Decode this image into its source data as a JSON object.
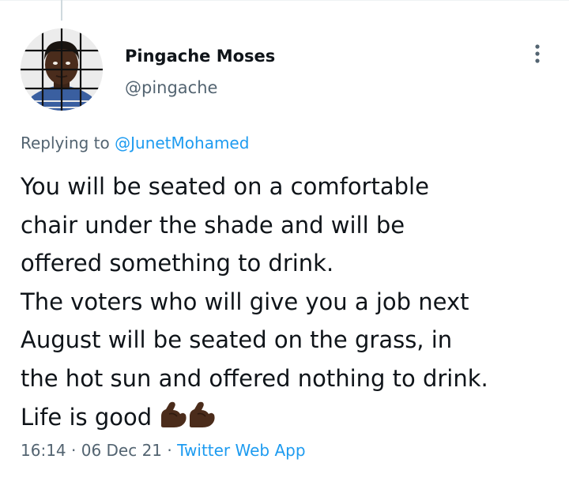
{
  "author": {
    "display_name": "Pingache Moses",
    "handle": "@pingache"
  },
  "reply": {
    "prefix": "Replying to",
    "mention": "@JunetMohamed"
  },
  "tweet": {
    "lines": [
      "You will be seated on a comfortable",
      "chair under the shade and will be",
      "offered something to drink.",
      "The voters who will give you a job next",
      "August will be seated on the grass, in",
      "the hot sun and offered nothing to drink.",
      "Life is good"
    ],
    "emoji": [
      "flexed-biceps-dark-skin",
      "flexed-biceps-dark-skin"
    ]
  },
  "meta": {
    "time": "16:14",
    "separator": "·",
    "date": "06 Dec 21",
    "source": "Twitter Web App"
  },
  "icons": {
    "more": "more-vertical-icon"
  },
  "colors": {
    "accent": "#1d9bf0",
    "text": "#0f1419",
    "secondary": "#536471"
  }
}
